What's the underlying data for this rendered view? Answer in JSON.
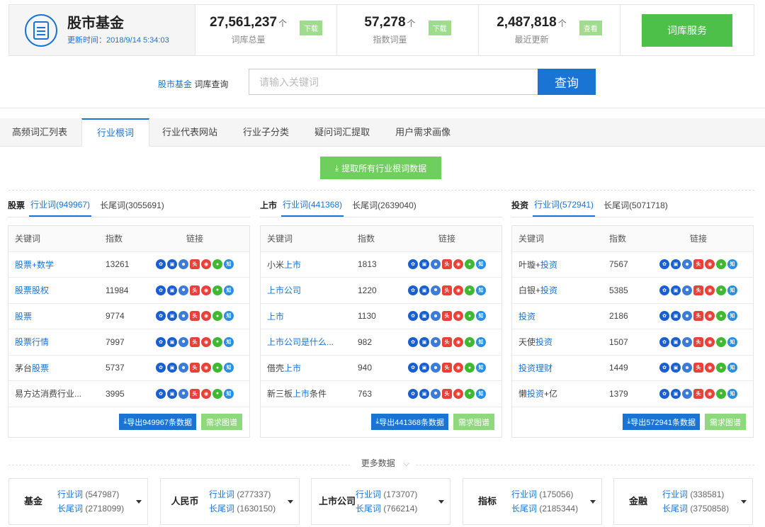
{
  "header": {
    "brand_name": "股市基金",
    "update_time": "更新时间：2018/9/14 5:34:03",
    "stats": [
      {
        "value": "27,561,237",
        "unit": "个",
        "label": "词库总量",
        "action": "下载"
      },
      {
        "value": "57,278",
        "unit": "个",
        "label": "指数词量",
        "action": "下载"
      },
      {
        "value": "2,487,818",
        "unit": "个",
        "label": "最近更新",
        "action": "查看"
      }
    ],
    "service_button": "词库服务"
  },
  "search": {
    "keyword": "股市基金",
    "label_suffix": " 词库查询",
    "placeholder": "请输入关键词",
    "button": "查询"
  },
  "tabs": [
    "高频词汇列表",
    "行业根词",
    "行业代表网站",
    "行业子分类",
    "疑问词汇提取",
    "用户需求画像"
  ],
  "active_tab": "行业根词",
  "fetch_button": "提取所有行业根词数据",
  "table_headers": {
    "keyword": "关键词",
    "index": "指数",
    "links": "链接"
  },
  "icon_colors": [
    "#1a5fd0",
    "#1a5fd0",
    "#3d7bd8",
    "#e8413a",
    "#e8413a",
    "#3fb832",
    "#2b8ee0"
  ],
  "panels": [
    {
      "category": "股票",
      "industry_tab": "行业词(949967)",
      "longtail_tab": "长尾词(3055691)",
      "rows": [
        {
          "parts": [
            {
              "t": "股票",
              "hl": true
            },
            {
              "t": "+数学",
              "hl": true
            }
          ],
          "index": "13261"
        },
        {
          "parts": [
            {
              "t": "股票股权",
              "hl": true
            }
          ],
          "index": "11984"
        },
        {
          "parts": [
            {
              "t": "股票",
              "hl": true
            }
          ],
          "index": "9774"
        },
        {
          "parts": [
            {
              "t": "股票行情",
              "hl": true
            }
          ],
          "index": "7997"
        },
        {
          "parts": [
            {
              "t": "茅台",
              "hl": false
            },
            {
              "t": "股票",
              "hl": true
            }
          ],
          "index": "5737"
        },
        {
          "parts": [
            {
              "t": "易方达消费行业...",
              "hl": false
            }
          ],
          "index": "3995"
        }
      ],
      "export_label": "导出949967条数据",
      "request_label": "需求图谱"
    },
    {
      "category": "上市",
      "industry_tab": "行业词(441368)",
      "longtail_tab": "长尾词(2639040)",
      "rows": [
        {
          "parts": [
            {
              "t": "小米",
              "hl": false
            },
            {
              "t": "上市",
              "hl": true
            }
          ],
          "index": "1813"
        },
        {
          "parts": [
            {
              "t": "上市公司",
              "hl": true
            }
          ],
          "index": "1220"
        },
        {
          "parts": [
            {
              "t": "上市",
              "hl": true
            }
          ],
          "index": "1130"
        },
        {
          "parts": [
            {
              "t": "上市公司是什么...",
              "hl": true
            }
          ],
          "index": "982"
        },
        {
          "parts": [
            {
              "t": "借壳",
              "hl": false
            },
            {
              "t": "上市",
              "hl": true
            }
          ],
          "index": "940"
        },
        {
          "parts": [
            {
              "t": "新三板",
              "hl": false
            },
            {
              "t": "上市",
              "hl": true
            },
            {
              "t": "条件",
              "hl": false
            }
          ],
          "index": "763"
        }
      ],
      "export_label": "导出441368条数据",
      "request_label": "需求图谱"
    },
    {
      "category": "投资",
      "industry_tab": "行业词(572941)",
      "longtail_tab": "长尾词(5071718)",
      "rows": [
        {
          "parts": [
            {
              "t": "叶璇+",
              "hl": false
            },
            {
              "t": "投资",
              "hl": true
            }
          ],
          "index": "7567"
        },
        {
          "parts": [
            {
              "t": "白银+",
              "hl": false
            },
            {
              "t": "投资",
              "hl": true
            }
          ],
          "index": "5385"
        },
        {
          "parts": [
            {
              "t": "投资",
              "hl": true
            }
          ],
          "index": "2186"
        },
        {
          "parts": [
            {
              "t": "天使",
              "hl": false
            },
            {
              "t": "投资",
              "hl": true
            }
          ],
          "index": "1507"
        },
        {
          "parts": [
            {
              "t": "投资理财",
              "hl": true
            }
          ],
          "index": "1449"
        },
        {
          "parts": [
            {
              "t": "懒",
              "hl": false
            },
            {
              "t": "投资",
              "hl": true
            },
            {
              "t": "+亿",
              "hl": false
            }
          ],
          "index": "1379"
        }
      ],
      "export_label": "导出572941条数据",
      "request_label": "需求图谱"
    }
  ],
  "more_label": "更多数据",
  "bottom_cards": [
    {
      "name": "基金",
      "industry": "行业词 (547987)",
      "longtail": "长尾词 (2718099)"
    },
    {
      "name": "人民币",
      "industry": "行业词 (277337)",
      "longtail": "长尾词 (1630150)"
    },
    {
      "name": "上市公司",
      "industry": "行业词 (173707)",
      "longtail": "长尾词 (766214)"
    },
    {
      "name": "指标",
      "industry": "行业词 (175056)",
      "longtail": "长尾词 (2185344)"
    },
    {
      "name": "金融",
      "industry": "行业词 (338581)",
      "longtail": "长尾词 (3750858)"
    }
  ]
}
